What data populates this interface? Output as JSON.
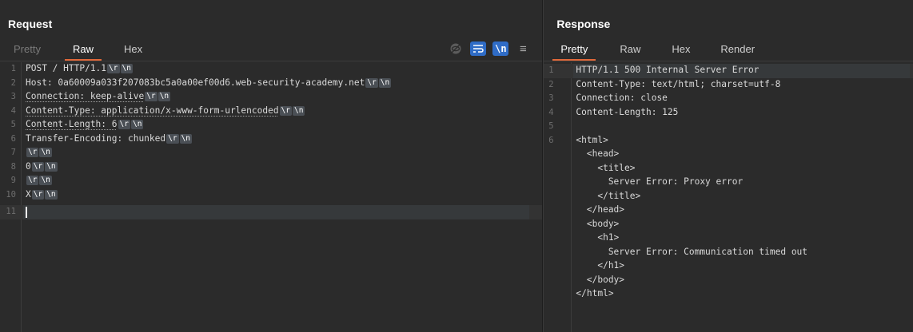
{
  "request": {
    "title": "Request",
    "tabs": [
      "Pretty",
      "Raw",
      "Hex"
    ],
    "icons": [
      "eye-off-icon",
      "wrap-icon",
      "newline-icon",
      "menu-icon"
    ],
    "newline_label": "\\n",
    "menu_glyph": "≡",
    "lines": [
      {
        "num": "1",
        "text": "POST / HTTP/1.1"
      },
      {
        "num": "2",
        "text": "Host: 0a60009a033f207083bc5a0a00ef00d6.web-security-academy.net"
      },
      {
        "num": "3",
        "text": "Connection: keep-alive"
      },
      {
        "num": "4",
        "text": "Content-Type: application/x-www-form-urlencoded"
      },
      {
        "num": "5",
        "text": "Content-Length: 6"
      },
      {
        "num": "6",
        "text": "Transfer-Encoding: chunked"
      },
      {
        "num": "7",
        "text": ""
      },
      {
        "num": "8",
        "text": "0"
      },
      {
        "num": "9",
        "text": ""
      },
      {
        "num": "10",
        "text": "X"
      },
      {
        "num": "11",
        "text": ""
      }
    ],
    "crlf_r": "\\r",
    "crlf_n": "\\n"
  },
  "response": {
    "title": "Response",
    "tabs": [
      "Pretty",
      "Raw",
      "Hex",
      "Render"
    ],
    "lines": [
      {
        "num": "1",
        "text": "HTTP/1.1 500 Internal Server Error"
      },
      {
        "num": "2",
        "text": "Content-Type: text/html; charset=utf-8"
      },
      {
        "num": "3",
        "text": "Connection: close"
      },
      {
        "num": "4",
        "text": "Content-Length: 125"
      },
      {
        "num": "5",
        "text": ""
      },
      {
        "num": "6",
        "text": "<html>"
      },
      {
        "num": "",
        "text": "  <head>"
      },
      {
        "num": "",
        "text": "    <title>"
      },
      {
        "num": "",
        "text": "      Server Error: Proxy error"
      },
      {
        "num": "",
        "text": "    </title>"
      },
      {
        "num": "",
        "text": "  </head>"
      },
      {
        "num": "",
        "text": "  <body>"
      },
      {
        "num": "",
        "text": "    <h1>"
      },
      {
        "num": "",
        "text": "      Server Error: Communication timed out"
      },
      {
        "num": "",
        "text": "    </h1>"
      },
      {
        "num": "",
        "text": "  </body>"
      },
      {
        "num": "",
        "text": "</html>"
      }
    ]
  },
  "colors": {
    "accent": "#e0683a",
    "tag": "#d6a23a",
    "button_blue": "#2f6cc6"
  }
}
